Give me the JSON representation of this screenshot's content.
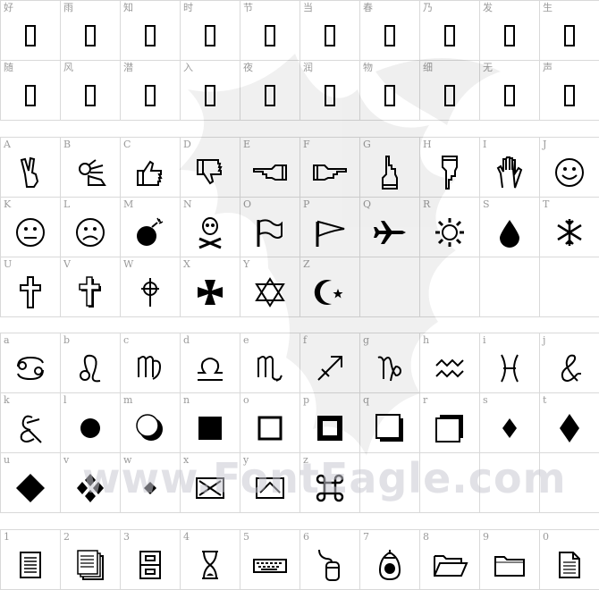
{
  "watermark": {
    "text": "www.FontEagle.com",
    "icon": "eagle-icon"
  },
  "blocks": [
    {
      "cells": [
        {
          "label": "好",
          "glyph": "tofu"
        },
        {
          "label": "雨",
          "glyph": "tofu"
        },
        {
          "label": "知",
          "glyph": "tofu"
        },
        {
          "label": "时",
          "glyph": "tofu"
        },
        {
          "label": "节",
          "glyph": "tofu"
        },
        {
          "label": "当",
          "glyph": "tofu"
        },
        {
          "label": "春",
          "glyph": "tofu"
        },
        {
          "label": "乃",
          "glyph": "tofu"
        },
        {
          "label": "发",
          "glyph": "tofu"
        },
        {
          "label": "生",
          "glyph": "tofu"
        },
        {
          "label": "随",
          "glyph": "tofu"
        },
        {
          "label": "风",
          "glyph": "tofu"
        },
        {
          "label": "潜",
          "glyph": "tofu"
        },
        {
          "label": "入",
          "glyph": "tofu"
        },
        {
          "label": "夜",
          "glyph": "tofu"
        },
        {
          "label": "润",
          "glyph": "tofu"
        },
        {
          "label": "物",
          "glyph": "tofu"
        },
        {
          "label": "细",
          "glyph": "tofu"
        },
        {
          "label": "无",
          "glyph": "tofu"
        },
        {
          "label": "声",
          "glyph": "tofu"
        }
      ]
    },
    {
      "cells": [
        {
          "label": "A",
          "glyph": "victory-hand-icon"
        },
        {
          "label": "B",
          "glyph": "ok-hand-icon"
        },
        {
          "label": "C",
          "glyph": "thumbs-up-icon"
        },
        {
          "label": "D",
          "glyph": "thumbs-down-icon"
        },
        {
          "label": "E",
          "glyph": "point-left-icon"
        },
        {
          "label": "F",
          "glyph": "point-right-icon"
        },
        {
          "label": "G",
          "glyph": "point-up-icon"
        },
        {
          "label": "H",
          "glyph": "point-down-icon"
        },
        {
          "label": "I",
          "glyph": "open-hand-icon"
        },
        {
          "label": "J",
          "glyph": "smiley-icon"
        },
        {
          "label": "K",
          "glyph": "neutral-face-icon"
        },
        {
          "label": "L",
          "glyph": "frown-face-icon"
        },
        {
          "label": "M",
          "glyph": "bomb-icon"
        },
        {
          "label": "N",
          "glyph": "skull-crossbones-icon"
        },
        {
          "label": "O",
          "glyph": "flag-icon"
        },
        {
          "label": "P",
          "glyph": "pennant-icon"
        },
        {
          "label": "Q",
          "glyph": "airplane-icon"
        },
        {
          "label": "R",
          "glyph": "sun-icon"
        },
        {
          "label": "S",
          "glyph": "droplet-icon"
        },
        {
          "label": "T",
          "glyph": "snowflake-icon"
        },
        {
          "label": "U",
          "glyph": "latin-cross-icon"
        },
        {
          "label": "V",
          "glyph": "shadowed-cross-icon"
        },
        {
          "label": "W",
          "glyph": "celtic-cross-icon"
        },
        {
          "label": "X",
          "glyph": "maltese-cross-icon"
        },
        {
          "label": "Y",
          "glyph": "star-of-david-icon"
        },
        {
          "label": "Z",
          "glyph": "star-crescent-icon"
        },
        {
          "label": "",
          "glyph": ""
        },
        {
          "label": "",
          "glyph": ""
        },
        {
          "label": "",
          "glyph": ""
        },
        {
          "label": "",
          "glyph": ""
        }
      ]
    },
    {
      "cells": [
        {
          "label": "a",
          "glyph": "cancer-icon"
        },
        {
          "label": "b",
          "glyph": "leo-icon"
        },
        {
          "label": "c",
          "glyph": "virgo-icon"
        },
        {
          "label": "d",
          "glyph": "libra-icon"
        },
        {
          "label": "e",
          "glyph": "scorpio-icon"
        },
        {
          "label": "f",
          "glyph": "sagittarius-icon"
        },
        {
          "label": "g",
          "glyph": "capricorn-icon"
        },
        {
          "label": "h",
          "glyph": "aquarius-icon"
        },
        {
          "label": "i",
          "glyph": "pisces-icon"
        },
        {
          "label": "j",
          "glyph": "ampersand-italic-icon"
        },
        {
          "label": "k",
          "glyph": "et-ligature-icon"
        },
        {
          "label": "l",
          "glyph": "black-circle-icon"
        },
        {
          "label": "m",
          "glyph": "shadowed-circle-icon"
        },
        {
          "label": "n",
          "glyph": "black-square-icon"
        },
        {
          "label": "o",
          "glyph": "hollow-square-icon"
        },
        {
          "label": "p",
          "glyph": "bold-hollow-square-icon"
        },
        {
          "label": "q",
          "glyph": "shadow-square-lower-right-icon"
        },
        {
          "label": "r",
          "glyph": "shadow-square-upper-right-icon"
        },
        {
          "label": "s",
          "glyph": "small-diamond-icon"
        },
        {
          "label": "t",
          "glyph": "tall-diamond-icon"
        },
        {
          "label": "u",
          "glyph": "large-diamond-icon"
        },
        {
          "label": "v",
          "glyph": "four-diamonds-icon"
        },
        {
          "label": "w",
          "glyph": "tiny-diamond-icon"
        },
        {
          "label": "x",
          "glyph": "boxed-x-icon"
        },
        {
          "label": "y",
          "glyph": "boxed-up-arrow-icon"
        },
        {
          "label": "z",
          "glyph": "command-key-icon"
        },
        {
          "label": "",
          "glyph": ""
        },
        {
          "label": "",
          "glyph": ""
        },
        {
          "label": "",
          "glyph": ""
        },
        {
          "label": "",
          "glyph": ""
        }
      ]
    },
    {
      "cells": [
        {
          "label": "1",
          "glyph": "document-icon"
        },
        {
          "label": "2",
          "glyph": "documents-stack-icon"
        },
        {
          "label": "3",
          "glyph": "file-cabinet-icon"
        },
        {
          "label": "4",
          "glyph": "hourglass-icon"
        },
        {
          "label": "5",
          "glyph": "keyboard-icon"
        },
        {
          "label": "6",
          "glyph": "mouse-icon"
        },
        {
          "label": "7",
          "glyph": "trackball-icon"
        },
        {
          "label": "8",
          "glyph": "open-folder-icon"
        },
        {
          "label": "9",
          "glyph": "closed-folder-icon"
        },
        {
          "label": "0",
          "glyph": "page-folded-icon"
        }
      ]
    }
  ]
}
